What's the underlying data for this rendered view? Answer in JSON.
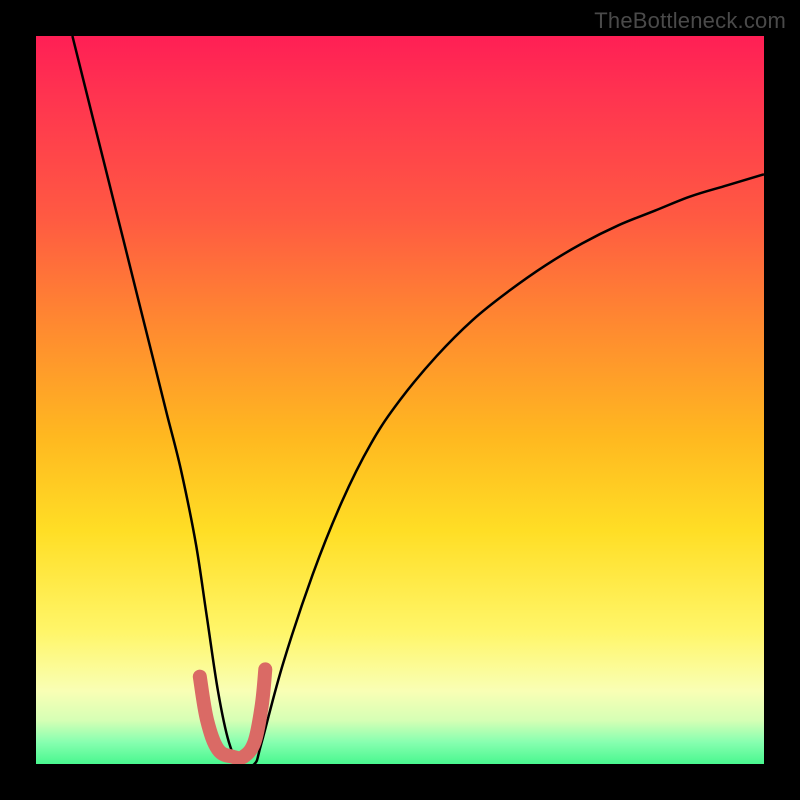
{
  "watermark": {
    "text": "TheBottleneck.com"
  },
  "chart_data": {
    "type": "line",
    "title": "",
    "xlabel": "",
    "ylabel": "",
    "xlim": [
      0,
      100
    ],
    "ylim": [
      0,
      100
    ],
    "grid": false,
    "legend": false,
    "background_gradient": {
      "orientation": "vertical",
      "stops": [
        {
          "pos": 0.0,
          "color": "#ff1f55"
        },
        {
          "pos": 0.25,
          "color": "#ff5a42"
        },
        {
          "pos": 0.55,
          "color": "#ffb820"
        },
        {
          "pos": 0.82,
          "color": "#fff66a"
        },
        {
          "pos": 0.94,
          "color": "#d6ffb5"
        },
        {
          "pos": 1.0,
          "color": "#49f78f"
        }
      ]
    },
    "series": [
      {
        "name": "bottleneck-curve",
        "color": "#000000",
        "x": [
          5,
          8,
          10,
          12,
          14,
          16,
          18,
          20,
          22,
          23.5,
          25,
          26.5,
          28,
          30,
          31,
          34,
          38,
          42,
          46,
          50,
          55,
          60,
          65,
          70,
          75,
          80,
          85,
          90,
          95,
          100
        ],
        "y": [
          100,
          88,
          80,
          72,
          64,
          56,
          48,
          40,
          30,
          20,
          10,
          3,
          0,
          0,
          3,
          14,
          26,
          36,
          44,
          50,
          56,
          61,
          65,
          68.5,
          71.5,
          74,
          76,
          78,
          79.5,
          81
        ]
      },
      {
        "name": "highlight-segment",
        "color": "#da6a65",
        "stroke_width_px": 14,
        "x": [
          22.5,
          23.5,
          25,
          27,
          28.5,
          30,
          31,
          31.5
        ],
        "y": [
          12,
          6,
          2,
          1,
          1,
          3,
          8,
          13
        ]
      }
    ],
    "annotations": [
      {
        "text": "TheBottleneck.com",
        "role": "watermark",
        "position": "top-right"
      }
    ]
  },
  "colors": {
    "curve": "#000000",
    "highlight": "#da6a65",
    "frame": "#000000",
    "watermark": "#4a4a4a"
  }
}
